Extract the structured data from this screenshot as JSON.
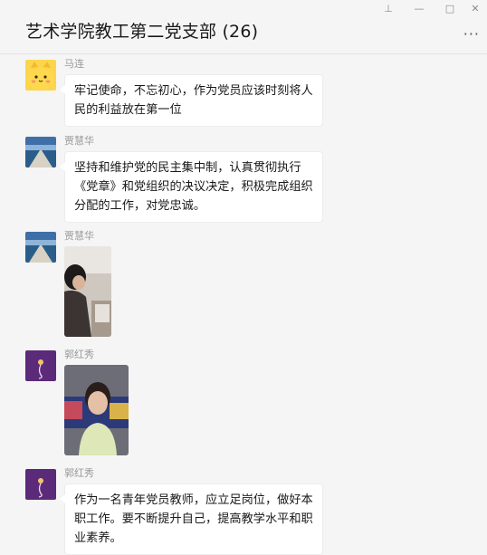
{
  "chat": {
    "title": "艺术学院教工第二党支部 (26)"
  },
  "window_controls": {
    "pin": "⊥",
    "minimize": "—",
    "maximize": "□",
    "close": "✕",
    "more": "···"
  },
  "messages": [
    {
      "sender": "马连",
      "avatar": "yellow-cat-avatar",
      "type": "text",
      "text": "牢记使命，不忘初心，作为党员应该时刻将人民的利益放在第一位"
    },
    {
      "sender": "贾慧华",
      "avatar": "seaside-pier-avatar",
      "type": "text",
      "text": "坚持和维护党的民主集中制，认真贯彻执行《党章》和党组织的决议决定，积极完成组织分配的工作，对党忠诚。"
    },
    {
      "sender": "贾慧华",
      "avatar": "seaside-pier-avatar",
      "type": "image",
      "image": "photo-person-studying"
    },
    {
      "sender": "郭红秀",
      "avatar": "purple-flower-avatar",
      "type": "image",
      "image": "photo-woman-portrait"
    },
    {
      "sender": "郭红秀",
      "avatar": "purple-flower-avatar",
      "type": "text",
      "text": "作为一名青年党员教师，应立足岗位，做好本职工作。要不断提升自己，提高教学水平和职业素养。"
    }
  ],
  "colors": {
    "background": "#f5f5f5",
    "bubble": "#ffffff",
    "sender": "#999999",
    "title": "#1a1a1a"
  }
}
